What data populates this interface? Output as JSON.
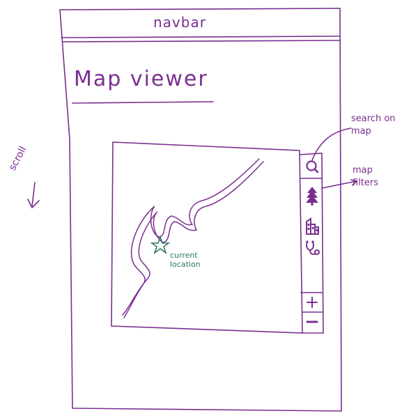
{
  "navbar": {
    "label": "navbar"
  },
  "page": {
    "title": "Map viewer",
    "scroll_hint": "scroll"
  },
  "map": {
    "current_location_label": "current location"
  },
  "map_toolbar": {
    "buttons": [
      {
        "name": "search-on-map",
        "icon": "search-icon"
      },
      {
        "name": "filter-trees",
        "icon": "tree-icon"
      },
      {
        "name": "filter-buildings",
        "icon": "building-icon"
      },
      {
        "name": "filter-medical",
        "icon": "stethoscope-icon"
      }
    ],
    "zoom": {
      "in_icon": "plus-icon",
      "out_icon": "minus-icon"
    }
  },
  "annotations": {
    "search": "search on map",
    "filters": "map filters"
  },
  "colors": {
    "ink": "#7a2e8f",
    "location_ink": "#2f7a5a",
    "background": "#ffffff"
  }
}
